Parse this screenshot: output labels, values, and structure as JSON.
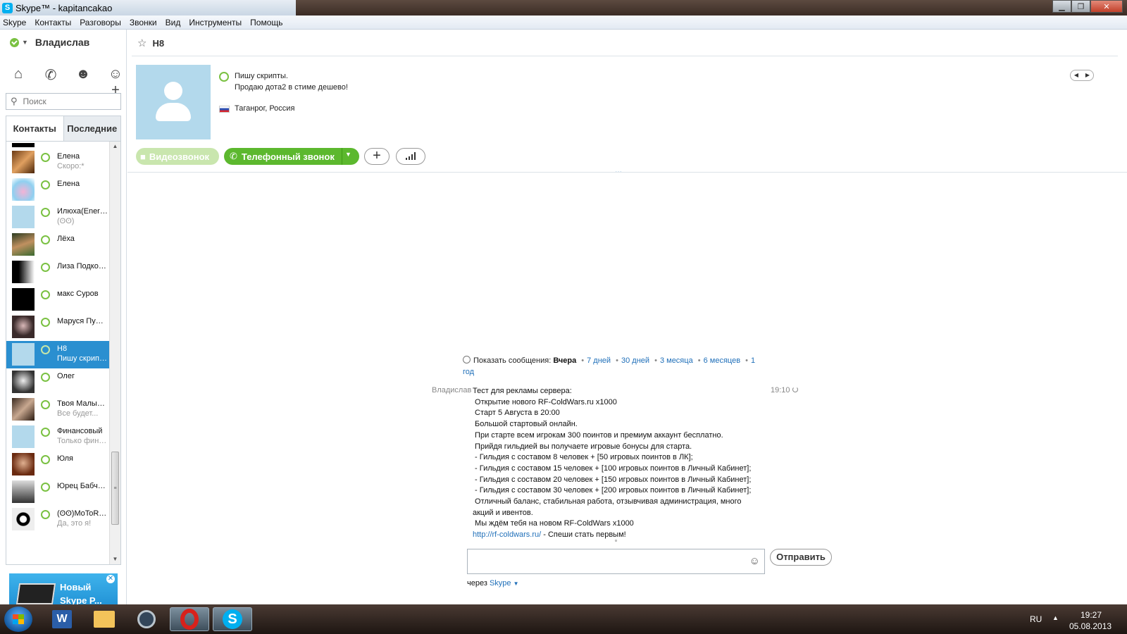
{
  "window": {
    "title": "Skype™ - kapitancakao",
    "app_icon": "S"
  },
  "menu": [
    "Skype",
    "Контакты",
    "Разговоры",
    "Звонки",
    "Вид",
    "Инструменты",
    "Помощь"
  ],
  "user": {
    "name": "Владислав",
    "status_color": "#7ac142"
  },
  "nav": {
    "home": "⌂",
    "call": "✆",
    "group": "☻",
    "add": "+"
  },
  "search": {
    "placeholder": "Поиск",
    "icon": "🔍"
  },
  "tabs": {
    "contacts": "Контакты",
    "recent": "Последние"
  },
  "contacts": [
    {
      "name": "Елена",
      "mood": "Скоро:*"
    },
    {
      "name": "Елена",
      "mood": ""
    },
    {
      "name": "Илюха(Energy)",
      "mood": "(ʘʘ)"
    },
    {
      "name": "Лёха",
      "mood": ""
    },
    {
      "name": "Лиза  Подкопаева",
      "mood": ""
    },
    {
      "name": "макс Суров",
      "mood": ""
    },
    {
      "name": "Маруся Пушкина",
      "mood": ""
    },
    {
      "name": "H8",
      "mood": "Пишу скрипты.",
      "selected": true
    },
    {
      "name": "Олег",
      "mood": ""
    },
    {
      "name": "Твоя Малышка",
      "mood": "Все будет..."
    },
    {
      "name": "Финансовый",
      "mood": "Только финансы"
    },
    {
      "name": "Юля",
      "mood": ""
    },
    {
      "name": "Юрец Бабченко",
      "mood": ""
    },
    {
      "name": "(ʘʘ)MoToRoLa",
      "mood": "Да, это я!"
    }
  ],
  "ad": {
    "line1": "Новый",
    "line2": "Skype P...",
    "close": "✕"
  },
  "conversation": {
    "name": "H8",
    "mood_line1": "Пишу скрипты.",
    "mood_line2": "Продаю дота2 в стиме дешево!",
    "location": "Таганрог, Россия",
    "nav_prev": "◀",
    "nav_next": "▶",
    "video_label": "Видеозвонок",
    "phone_label": "Телефонный звонок",
    "plus_label": "+",
    "more": "..."
  },
  "history": {
    "prefix": "Показать сообщения:",
    "current": "Вчера",
    "options": [
      "7 дней",
      "30 дней",
      "3 месяца",
      "6 месяцев",
      "1 год"
    ]
  },
  "message": {
    "sender": "Владислав",
    "time": "19:10",
    "lines": [
      "Тест для рекламы сервера:",
      " Открытие нового RF-ColdWars.ru x1000",
      " Старт 5 Августа в 20:00",
      " Большой стартовый онлайн.",
      " При старте всем игрокам 300 поинтов и премиум аккаунт бесплатно.",
      " Прийдя гильдией вы получаете игровые бонусы для старта.",
      " - Гильдия с составом 8 человек + [50 игровых поинтов в ЛК];",
      " - Гильдия с составом 15 человек + [100 игровых поинтов в Личный Кабинет];",
      " - Гильдия с составом 20 человек + [150 игровых поинтов в Личный Кабинет];",
      " - Гильдия с составом 30 человек + [200 игровых поинтов в Личный Кабинет];",
      " Отличный баланс, стабильная работа, отзывчивая администрация, много",
      "акций и ивентов.",
      " Мы ждём тебя на новом RF-ColdWars x1000"
    ],
    "link": "http://rf-coldwars.ru/",
    "link_suffix": " - Спеши стать первым!"
  },
  "compose": {
    "send_label": "Отправить",
    "emoji": "☺",
    "via_prefix": "через",
    "via_app": "Skype"
  },
  "taskbar": {
    "apps": [
      "windows-start",
      "word",
      "explorer",
      "steam",
      "opera",
      "skype"
    ],
    "lang": "RU",
    "tray_arrow": "▲",
    "time": "19:27",
    "date": "05.08.2013"
  }
}
